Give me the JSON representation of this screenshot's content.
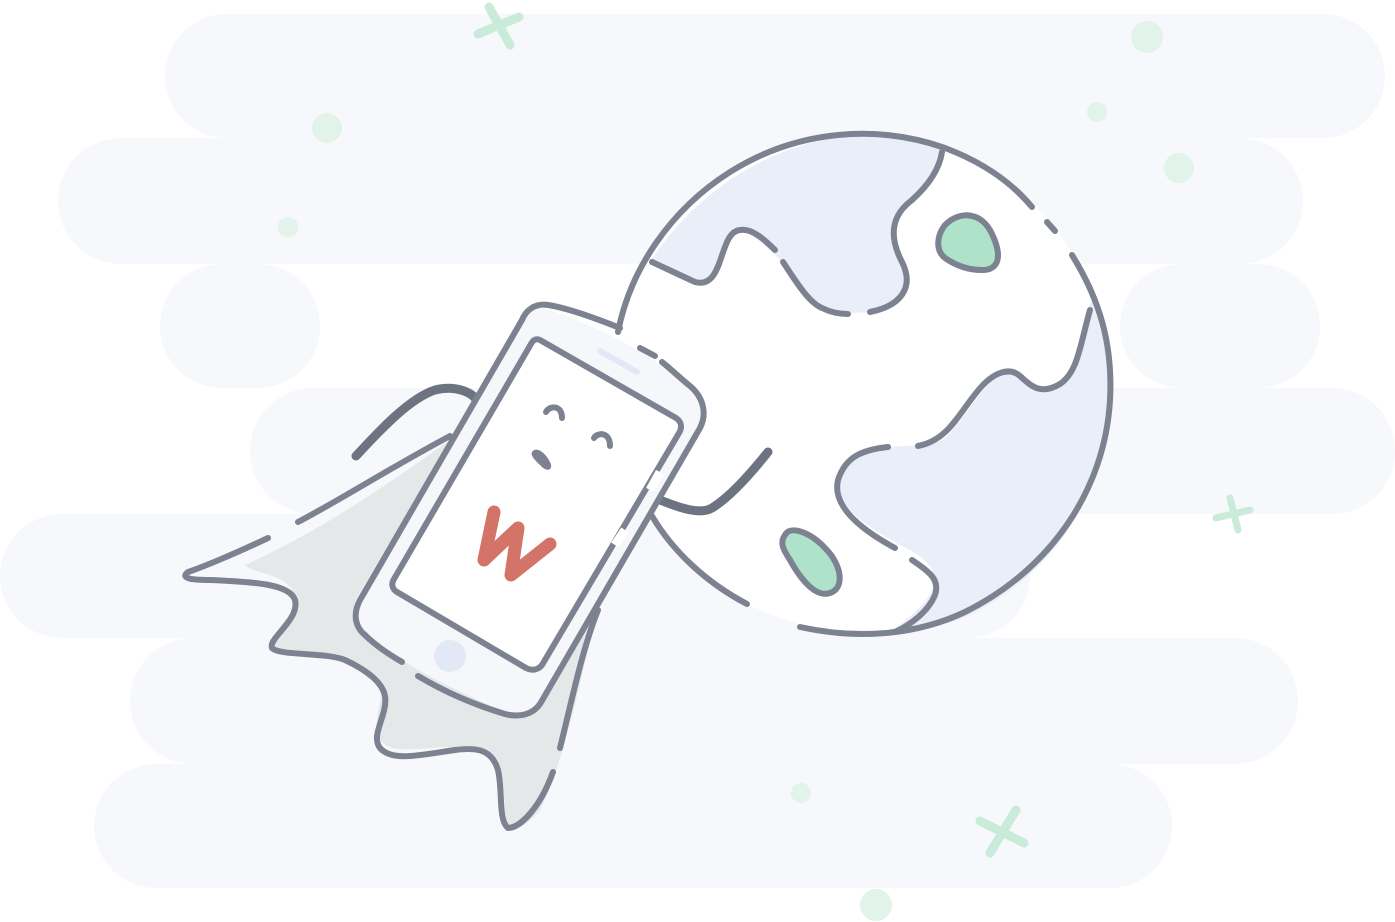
{
  "illustration": {
    "logo_letter": "W",
    "icons": [
      "cloud-band-icon",
      "globe-icon",
      "smartphone-icon",
      "cape-icon",
      "sparkle-icon",
      "dot-icon"
    ]
  },
  "colors": {
    "background": "#ffffff",
    "cloud": "#f7f8fb",
    "globe_land_fill": "#eaeef8",
    "outline": "#7d8291",
    "outline_dark": "#6e7382",
    "green_spot": "#aee2c9",
    "sparkle": "#c9ebd9",
    "logo_red": "#d47367",
    "cape_shadow": "#e4e8e9",
    "phone_screen": "#ffffff",
    "phone_body": "#f6f7fb",
    "home_button": "#e3e8f6"
  }
}
